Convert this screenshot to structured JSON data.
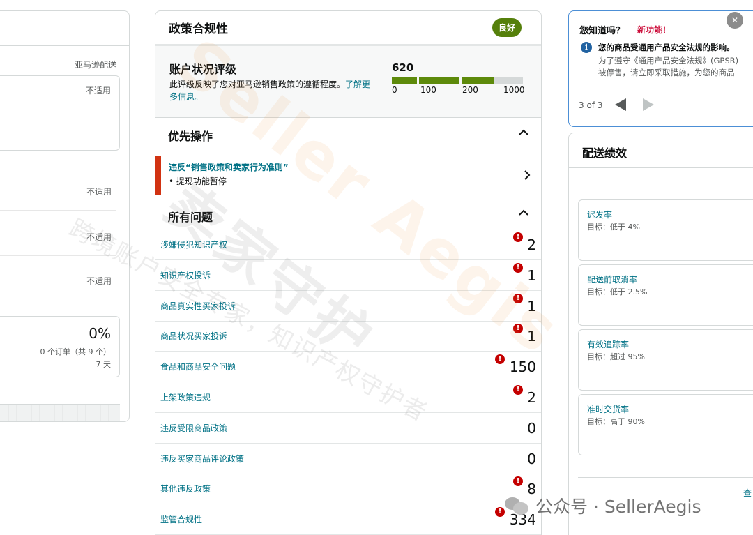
{
  "left_panel": {
    "col_label": "亚马逊配送",
    "na_values": [
      "不适用",
      "不适用",
      "不适用",
      "不适用"
    ],
    "percent": "0%",
    "orders": "0 个订单（共 9 个）",
    "days": "7 天"
  },
  "policy": {
    "title": "政策合规性",
    "status_badge": "良好",
    "ahr": {
      "title": "账户状况评级",
      "desc": "此评级反映了您对亚马逊销售政策的遵循程度。",
      "link": "了解更多信息。",
      "score": "620",
      "ticks": [
        "0",
        "100",
        "200",
        "1000"
      ],
      "colors": {
        "good": "#5d8a0b",
        "rest": "#d5d9d9"
      }
    },
    "priority": {
      "title": "优先操作",
      "item_title": "违反“销售政策和卖家行为准则”",
      "item_sub": "• 提现功能暂停"
    },
    "all_issues": {
      "title": "所有问题",
      "items": [
        {
          "label": "涉嫌侵犯知识产权",
          "count": "2",
          "alert": true
        },
        {
          "label": "知识产权投诉",
          "count": "1",
          "alert": true
        },
        {
          "label": "商品真实性买家投诉",
          "count": "1",
          "alert": true
        },
        {
          "label": "商品状况买家投诉",
          "count": "1",
          "alert": true
        },
        {
          "label": "食品和商品安全问题",
          "count": "150",
          "alert": true
        },
        {
          "label": "上架政策违规",
          "count": "2",
          "alert": true
        },
        {
          "label": "违反受限商品政策",
          "count": "0",
          "alert": false
        },
        {
          "label": "违反买家商品评论政策",
          "count": "0",
          "alert": false
        },
        {
          "label": "其他违反政策",
          "count": "8",
          "alert": true
        },
        {
          "label": "监管合规性",
          "count": "334",
          "alert": true
        }
      ]
    }
  },
  "did_you_know": {
    "title": "您知道吗？",
    "new_label": "新功能！",
    "line1": "您的商品受通用产品安全法规的影响。",
    "line2": "为了遵守《通用产品安全法规》(GPSR)",
    "line3": "被停售，请立即采取措施，为您的商品",
    "pager": "3 of 3"
  },
  "shipping": {
    "title": "配送绩效",
    "metrics": [
      {
        "name": "迟发率",
        "target": "目标：低于 4%"
      },
      {
        "name": "配送前取消率",
        "target": "目标：低于 2.5%"
      },
      {
        "name": "有效追踪率",
        "target": "目标：超过 95%"
      },
      {
        "name": "准时交货率",
        "target": "目标：高于 90%"
      }
    ],
    "link": "查"
  },
  "watermark": {
    "brand": "Seller Aegis",
    "cn": "卖家守护",
    "slogan": "跨境账户安全专家，知识产权守护者",
    "wechat": "公众号 · SellerAegis"
  }
}
